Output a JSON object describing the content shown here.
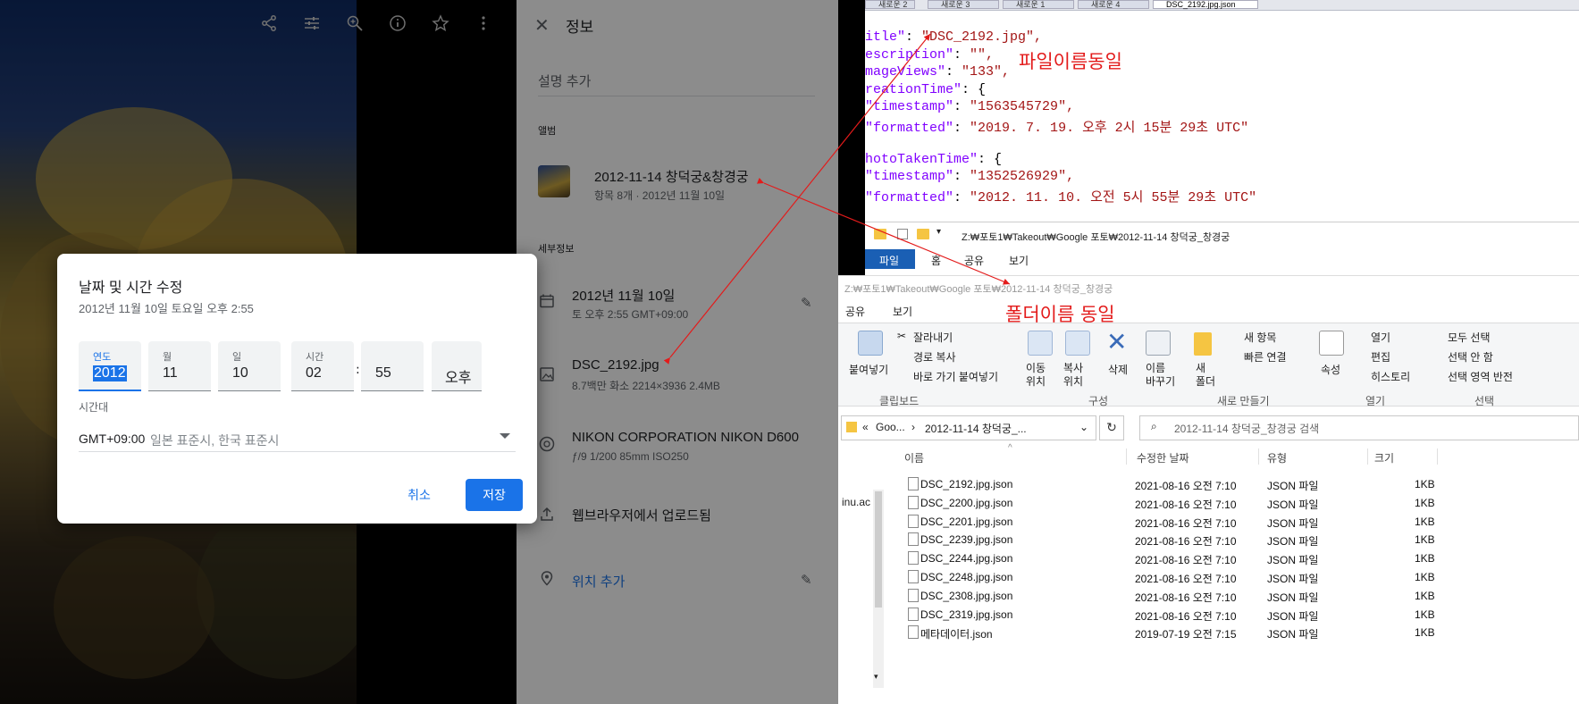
{
  "photo_toolbar": {
    "icons": [
      "share-icon",
      "tune-icon",
      "zoom-in-icon",
      "info-icon",
      "star-icon",
      "more-vert-icon"
    ]
  },
  "info_panel": {
    "title": "정보",
    "add_description": "설명 추가",
    "albums_header": "앨범",
    "album_name": "2012-11-14 창덕궁&창경궁",
    "album_meta": "항목 8개  ·  2012년 11월 10일",
    "details_header": "세부정보",
    "date_main": "2012년 11월 10일",
    "date_sub": "토 오후 2:55   GMT+09:00",
    "file_name": "DSC_2192.jpg",
    "file_meta": "8.7백만 화소   2214×3936   2.4MB",
    "camera": "NIKON CORPORATION NIKON D600",
    "camera_meta": "ƒ/9   1/200   85mm   ISO250",
    "upload": "웹브라우저에서 업로드됨",
    "add_location": "위치 추가"
  },
  "dialog": {
    "title": "날짜 및 시간 수정",
    "subtitle": "2012년 11월 10일 토요일 오후 2:55",
    "fields": [
      {
        "label": "연도",
        "value": "2012"
      },
      {
        "label": "월",
        "value": "11"
      },
      {
        "label": "일",
        "value": "10"
      },
      {
        "label": "시간",
        "value": "02"
      },
      {
        "label": "",
        "value": "55"
      },
      {
        "label": "",
        "value": "오후"
      }
    ],
    "time_separator": ":",
    "timezone_label": "시간대",
    "timezone_value": "GMT+09:00",
    "timezone_desc": "일본 표준시, 한국 표준시",
    "cancel": "취소",
    "save": "저장"
  },
  "editor": {
    "tabs": [
      "새로운 2",
      "새로운 3",
      "새로운 1",
      "새로운 4",
      "DSC_2192.jpg.json"
    ],
    "lines": [
      {
        "key": "itle\"",
        "value": "\"DSC_2192.jpg\","
      },
      {
        "key": "escription\"",
        "value": "\"\","
      },
      {
        "key": "mageViews\"",
        "value": "\"133\","
      },
      {
        "key": "reationTime\"",
        "value": "{"
      },
      {
        "key": "\"timestamp\"",
        "value": "\"1563545729\","
      },
      {
        "key": "\"formatted\"",
        "value": "\"2019. 7. 19. 오후 2시 15분 29초 UTC\""
      },
      {
        "key": "",
        "value": ""
      },
      {
        "key": "hotoTakenTime\"",
        "value": "{"
      },
      {
        "key": "\"timestamp\"",
        "value": "\"1352526929\","
      },
      {
        "key": "\"formatted\"",
        "value": "\"2012. 11. 10. 오전 5시 55분 29초 UTC\""
      }
    ]
  },
  "annotations": {
    "filename_same": "파일이름동일",
    "folder_same": "폴더이름 동일"
  },
  "explorer_back": {
    "path": "Z:₩포토1₩Takeout₩Google 포토₩2012-11-14 창덕궁_창경궁",
    "tabs": [
      "파일",
      "홈",
      "공유",
      "보기"
    ]
  },
  "explorer": {
    "path_faded": "Z:₩포토1₩Takeout₩Google 포토₩2012-11-14 창덕궁_창경궁",
    "tabs": [
      "공유",
      "보기"
    ],
    "ribbon": {
      "clipboard": {
        "paste": "붙여넣기",
        "cut": "잘라내기",
        "copy_path": "경로 복사",
        "paste_shortcut": "바로 가기 붙여넣기",
        "group": "클립보드"
      },
      "organize": {
        "move": "이동\n위치",
        "copy": "복사\n위치",
        "delete": "삭제",
        "rename": "이름\n바꾸기",
        "group": "구성"
      },
      "new": {
        "new_item": "새 항목",
        "easy_access": "빠른 연결",
        "new_folder": "새\n폴더",
        "group": "새로 만들기"
      },
      "open": {
        "properties": "속성",
        "open": "열기",
        "edit": "편집",
        "history": "히스토리",
        "group": "열기"
      },
      "select": {
        "select_all": "모두 선택",
        "select_none": "선택 안 함",
        "invert": "선택 영역 반전",
        "group": "선택"
      }
    },
    "breadcrumb": [
      "Goo...",
      "2012-11-14 창덕궁_..."
    ],
    "search_placeholder": "2012-11-14 창덕궁_창경궁 검색",
    "side_text": "inu.ac",
    "columns": [
      "이름",
      "수정한 날짜",
      "유형",
      "크기"
    ],
    "rows": [
      {
        "name": "DSC_2192.jpg.json",
        "date": "2021-08-16 오전 7:10",
        "type": "JSON 파일",
        "size": "1KB"
      },
      {
        "name": "DSC_2200.jpg.json",
        "date": "2021-08-16 오전 7:10",
        "type": "JSON 파일",
        "size": "1KB"
      },
      {
        "name": "DSC_2201.jpg.json",
        "date": "2021-08-16 오전 7:10",
        "type": "JSON 파일",
        "size": "1KB"
      },
      {
        "name": "DSC_2239.jpg.json",
        "date": "2021-08-16 오전 7:10",
        "type": "JSON 파일",
        "size": "1KB"
      },
      {
        "name": "DSC_2244.jpg.json",
        "date": "2021-08-16 오전 7:10",
        "type": "JSON 파일",
        "size": "1KB"
      },
      {
        "name": "DSC_2248.jpg.json",
        "date": "2021-08-16 오전 7:10",
        "type": "JSON 파일",
        "size": "1KB"
      },
      {
        "name": "DSC_2308.jpg.json",
        "date": "2021-08-16 오전 7:10",
        "type": "JSON 파일",
        "size": "1KB"
      },
      {
        "name": "DSC_2319.jpg.json",
        "date": "2021-08-16 오전 7:10",
        "type": "JSON 파일",
        "size": "1KB"
      },
      {
        "name": "메타데이터.json",
        "date": "2019-07-19 오전 7:15",
        "type": "JSON 파일",
        "size": "1KB"
      }
    ]
  },
  "colors": {
    "accent_blue": "#1a73e8",
    "annotation_red": "#e31b1b",
    "json_key": "#8000ff",
    "json_string": "#a31515"
  }
}
